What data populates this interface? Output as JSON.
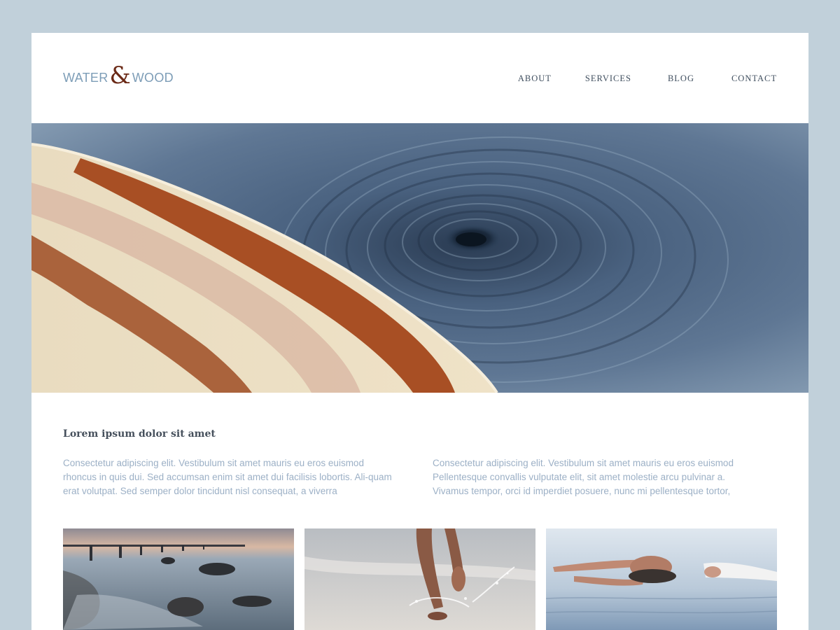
{
  "brand": {
    "word1": "WATER",
    "amp": "&",
    "word2": "WOOD"
  },
  "nav": {
    "items": [
      {
        "label": "ABOUT"
      },
      {
        "label": "SERVICES"
      },
      {
        "label": "BLOG"
      },
      {
        "label": "CONTACT"
      }
    ]
  },
  "hero": {
    "image": "surfboard-over-water-vortex"
  },
  "article": {
    "heading": "Lorem ipsum dolor sit amet",
    "col1": "Consectetur adipiscing elit. Vestibulum sit amet mauris eu eros euismod rhoncus in quis dui. Sed accumsan enim sit amet dui facilisis lobortis. Ali-quam erat volutpat. Sed semper dolor tincidunt nisl consequat, a viverra",
    "col2": "Consectetur adipiscing elit. Vestibulum sit amet mauris eu eros euismod Pellentesque convallis vulputate elit, sit amet molestie arcu pulvinar a. Vivamus tempor, orci id imperdiet posuere, nunc mi pellentesque tortor,"
  },
  "gallery": {
    "images": [
      "pier-at-sunset",
      "feet-running-on-beach",
      "woman-floating-in-water"
    ]
  },
  "colors": {
    "background": "#c1d0da",
    "brand_blue": "#7d9db7",
    "brand_amp": "#6b2a17",
    "nav_text": "#3f4e5e",
    "body_text": "#9cb0c6"
  }
}
